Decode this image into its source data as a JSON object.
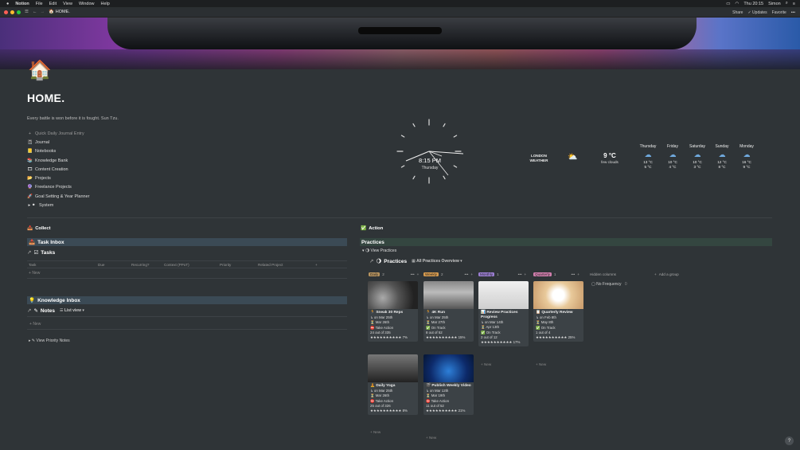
{
  "menubar": {
    "apple": "",
    "app": "Notion",
    "items": [
      "File",
      "Edit",
      "View",
      "Window",
      "Help"
    ],
    "clock": "Thu 20:15",
    "user": "Simon"
  },
  "titlebar": {
    "breadcrumb": "HOME.",
    "share": "Share",
    "updates": "Updates",
    "favorite": "Favorite"
  },
  "page": {
    "icon": "🏠",
    "title": "HOME.",
    "quote": "Every battle is won before it is fought. Sun Tzu."
  },
  "nav": [
    {
      "icon": "+",
      "label": "Quick Daily Journal Entry",
      "muted": true
    },
    {
      "icon": "📓",
      "label": "Journal"
    },
    {
      "icon": "📒",
      "label": "Notebooks"
    },
    {
      "icon": "📚",
      "label": "Knowledge Bank"
    },
    {
      "icon": "🎞",
      "label": "Content Creation"
    },
    {
      "icon": "📂",
      "label": "Projects"
    },
    {
      "icon": "🔮",
      "label": "Freelance Projects"
    },
    {
      "icon": "🚀",
      "label": "Goal Setting & Year Planner"
    },
    {
      "icon": "▸ ⚫",
      "label": "System"
    }
  ],
  "clock": {
    "time": "8:15 PM",
    "day": "Thursday"
  },
  "weather": {
    "city": "LONDON WEATHER",
    "temp": "9 °C",
    "desc": "few clouds",
    "forecast": [
      {
        "day": "Thursday",
        "high": "13 °C",
        "low": "5 °C"
      },
      {
        "day": "Friday",
        "high": "10 °C",
        "low": "4 °C"
      },
      {
        "day": "Saturday",
        "high": "10 °C",
        "low": "3 °C"
      },
      {
        "day": "Sunday",
        "high": "12 °C",
        "low": "8 °C"
      },
      {
        "day": "Monday",
        "high": "16 °C",
        "low": "9 °C"
      }
    ]
  },
  "collect": {
    "label": "Collect",
    "task_inbox": "Task Inbox",
    "tasks_link": "Tasks",
    "task_props": [
      "Task",
      "Due",
      "Recurring?",
      "Context (PPoT)",
      "Priority",
      "Related Project",
      "+"
    ],
    "new": "New",
    "knowledge_inbox": "Knowledge Inbox",
    "notes_link": "Notes",
    "notes_view": "List view",
    "notes_new": "New",
    "priority_notes": "View Priority Notes"
  },
  "action": {
    "label": "Action",
    "practices_band": "Practices",
    "view_practices": "View Practices",
    "practices_link": "Practices",
    "practices_view": "All Practices Overview",
    "hidden_columns": "Hidden columns",
    "no_frequency": "No Frequency",
    "no_frequency_count": "0",
    "add_group": "Add a group",
    "new": "New",
    "columns": [
      {
        "name": "Daily",
        "count": "2",
        "color": "#b8945f",
        "cards": [
          {
            "title": "Sneak 30 Reps",
            "start": "on Mar 25th",
            "due": "Mar 26th",
            "status": "Take Action",
            "progress": "24 out of 335",
            "stars": "★★★★★★★★★★ 7%"
          },
          {
            "title": "Daily Yoga",
            "start": "on Mar 25th",
            "due": "Mar 26th",
            "status": "Take Action",
            "progress": "25 out of 326",
            "stars": "★★★★★★★★★★ 8%"
          }
        ]
      },
      {
        "name": "Weekly",
        "count": "2",
        "color": "#d79b4f",
        "cards": [
          {
            "title": "4K Run",
            "start": "on Mar 25th",
            "due": "Mar 27th",
            "status": "On Track",
            "progress": "8 out of 52",
            "stars": "★★★★★★★★★★ 15%"
          },
          {
            "title": "Publish Weekly Video",
            "start": "on Mar 12th",
            "due": "Mar 19th",
            "status": "Take Action",
            "progress": "11 out of 52",
            "stars": "★★★★★★★★★★ 21%"
          }
        ]
      },
      {
        "name": "Monthly",
        "count": "1",
        "color": "#9c7fd4",
        "cards": [
          {
            "title": "Review Practices Progress",
            "start": "on Mar 14th",
            "due": "Apr 13th",
            "status": "On Track",
            "progress": "2 out of 12",
            "stars": "★★★★★★★★★★ 17%"
          }
        ]
      },
      {
        "name": "Quarterly",
        "count": "1",
        "color": "#d27fae",
        "cards": [
          {
            "title": "Quarterly Review",
            "start": "on Feb 8th",
            "due": "May 8th",
            "status": "On Track",
            "progress": "1 out of 4",
            "stars": "★★★★★★★★★★ 25%"
          }
        ]
      }
    ]
  },
  "help": "?"
}
